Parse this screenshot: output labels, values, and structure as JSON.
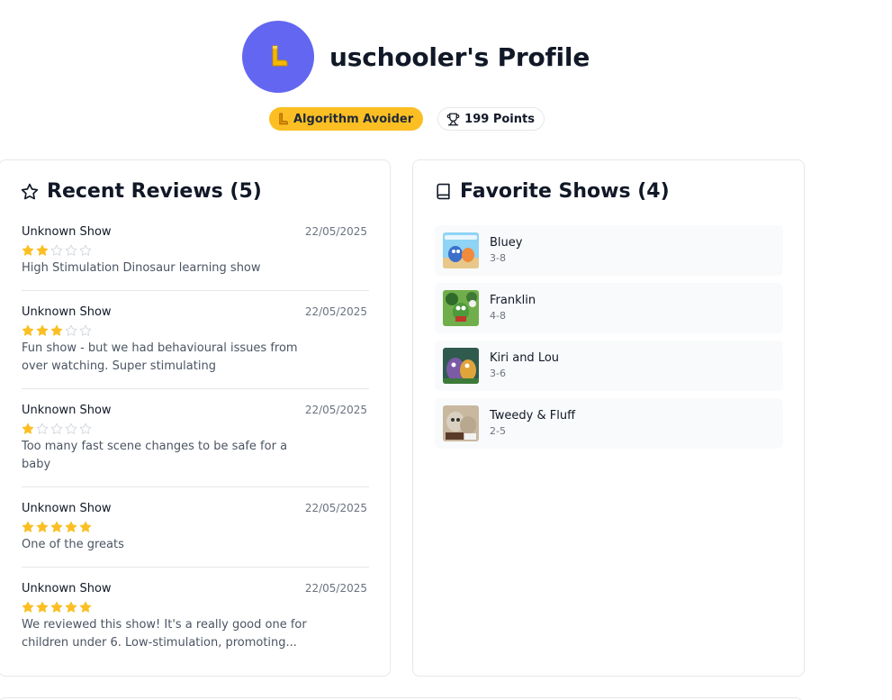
{
  "profile": {
    "title": "uschooler's Profile",
    "avatar_icon": "boot-icon",
    "avatar_color": "#6366f1"
  },
  "badges": {
    "achievement_label": "Algorithm Avoider",
    "achievement_icon": "boot-icon",
    "achievement_color": "#fbbf24",
    "points_label": "199 Points",
    "points_icon": "trophy-icon"
  },
  "reviews": {
    "title": "Recent Reviews (5)",
    "icon": "star-outline-icon",
    "items": [
      {
        "show": "Unknown Show",
        "date": "22/05/2025",
        "rating": 2,
        "text": "High Stimulation Dinosaur learning show"
      },
      {
        "show": "Unknown Show",
        "date": "22/05/2025",
        "rating": 3,
        "text": "Fun show - but we had behavioural issues from over watching. Super stimulating"
      },
      {
        "show": "Unknown Show",
        "date": "22/05/2025",
        "rating": 1,
        "text": "Too many fast scene changes to be safe for a baby"
      },
      {
        "show": "Unknown Show",
        "date": "22/05/2025",
        "rating": 5,
        "text": "One of the greats"
      },
      {
        "show": "Unknown Show",
        "date": "22/05/2025",
        "rating": 5,
        "text": "We reviewed this show! It's a really good one for children under 6. Low-stimulation, promoting..."
      }
    ]
  },
  "favorites": {
    "title": "Favorite Shows (4)",
    "icon": "book-icon",
    "items": [
      {
        "name": "Bluey",
        "age": "3-8"
      },
      {
        "name": "Franklin",
        "age": "4-8"
      },
      {
        "name": "Kiri and Lou",
        "age": "3-6"
      },
      {
        "name": "Tweedy & Fluff",
        "age": "2-5"
      }
    ]
  },
  "colors": {
    "star_filled": "#fbbf24",
    "star_empty": "#d1d5db"
  }
}
